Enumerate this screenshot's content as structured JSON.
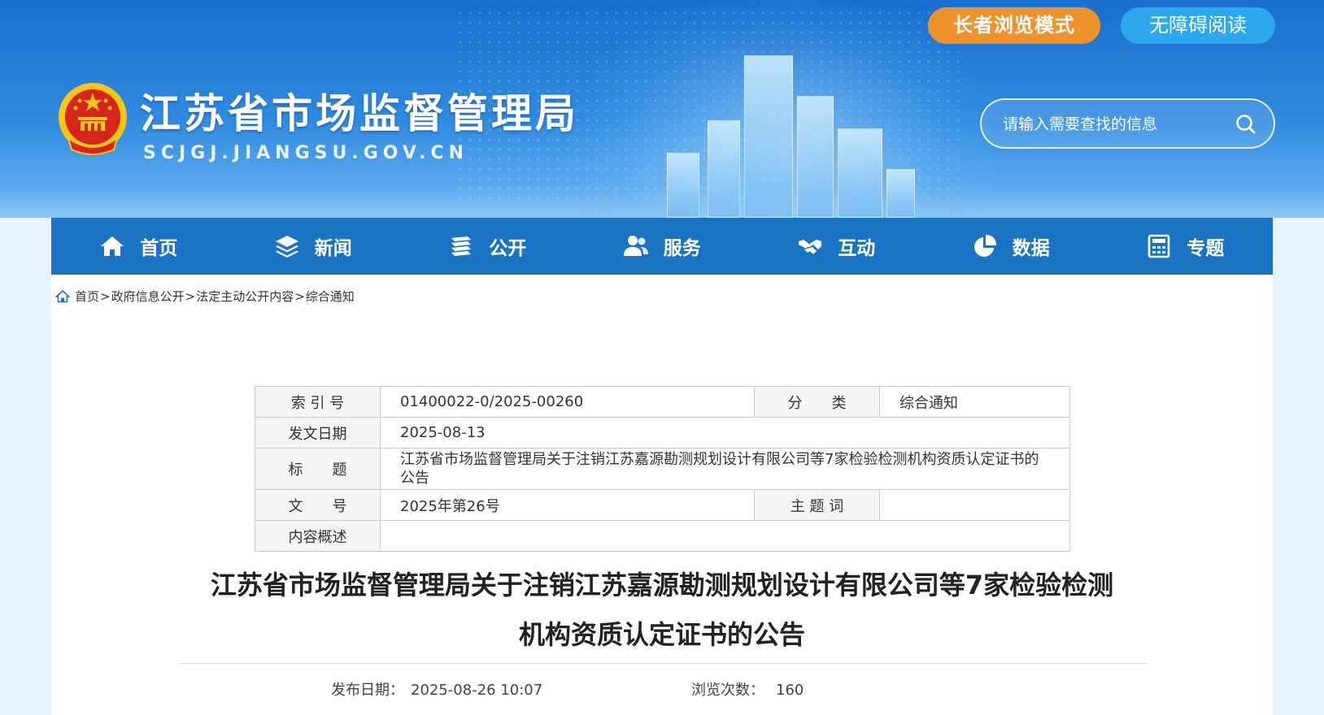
{
  "header": {
    "site_title": "江苏省市场监督管理局",
    "site_domain": "SCJGJ.JIANGSU.GOV.CN",
    "elder_mode_label": "长者浏览模式",
    "accessible_label": "无障碍阅读",
    "search": {
      "placeholder": "请输入需要查找的信息",
      "value": ""
    }
  },
  "nav": {
    "items": [
      {
        "label": "首页",
        "icon": "home-icon"
      },
      {
        "label": "新闻",
        "icon": "layers-icon"
      },
      {
        "label": "公开",
        "icon": "books-icon"
      },
      {
        "label": "服务",
        "icon": "people-icon"
      },
      {
        "label": "互动",
        "icon": "handshake-icon"
      },
      {
        "label": "数据",
        "icon": "pie-chart-icon"
      },
      {
        "label": "专题",
        "icon": "calculator-icon"
      }
    ]
  },
  "breadcrumb": [
    "首页",
    "政府信息公开",
    "法定主动公开内容",
    "综合通知"
  ],
  "info": {
    "index_label": "索 引 号",
    "index_value": "01400022-0/2025-00260",
    "category_label": "分　　类",
    "category_value": "综合通知",
    "date_label": "发文日期",
    "date_value": "2025-08-13",
    "title_label": "标　　题",
    "title_value": "江苏省市场监督管理局关于注销江苏嘉源勘测规划设计有限公司等7家检验检测机构资质认定证书的公告",
    "doc_no_label": "文　　号",
    "doc_no_value": "2025年第26号",
    "keywords_label": "主 题 词",
    "keywords_value": "",
    "summary_label": "内容概述",
    "summary_value": ""
  },
  "article": {
    "title_line1": "江苏省市场监督管理局关于注销江苏嘉源勘测规划设计有限公司等7家检验检测",
    "title_line2": "机构资质认定证书的公告",
    "publish_label": "发布日期：",
    "publish_value": "2025-08-26 10:07",
    "views_label": "浏览次数：",
    "views_value": "160"
  },
  "colors": {
    "nav_bg": "#1b73c4",
    "elder_btn": "#f0922c",
    "access_btn": "#2ea8ec",
    "emblem_red": "#d8251c",
    "emblem_gold": "#f5c518"
  }
}
